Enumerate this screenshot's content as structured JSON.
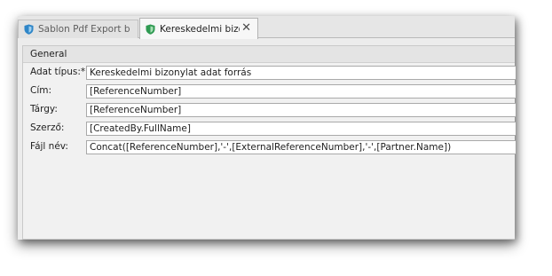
{
  "tabs": [
    {
      "label": "Sablon Pdf Export b",
      "icon": "shield-icon"
    },
    {
      "label": "Kereskedelmi bizony",
      "icon": "shield-icon",
      "close": "✕"
    }
  ],
  "group": {
    "title": "General"
  },
  "fields": [
    {
      "label": "Adat típus:*",
      "value": "Kereskedelmi bizonylat adat forrás"
    },
    {
      "label": "Cím:",
      "value": "[ReferenceNumber]"
    },
    {
      "label": "Tárgy:",
      "value": "[ReferenceNumber]"
    },
    {
      "label": "Szerző:",
      "value": "[CreatedBy.FullName]"
    },
    {
      "label": "Fájl név:",
      "value": "Concat([ReferenceNumber],'-',[ExternalReferenceNumber],'-',[Partner.Name])"
    }
  ],
  "colors": {
    "shield": "#2f86c8",
    "background": "#ececec"
  }
}
